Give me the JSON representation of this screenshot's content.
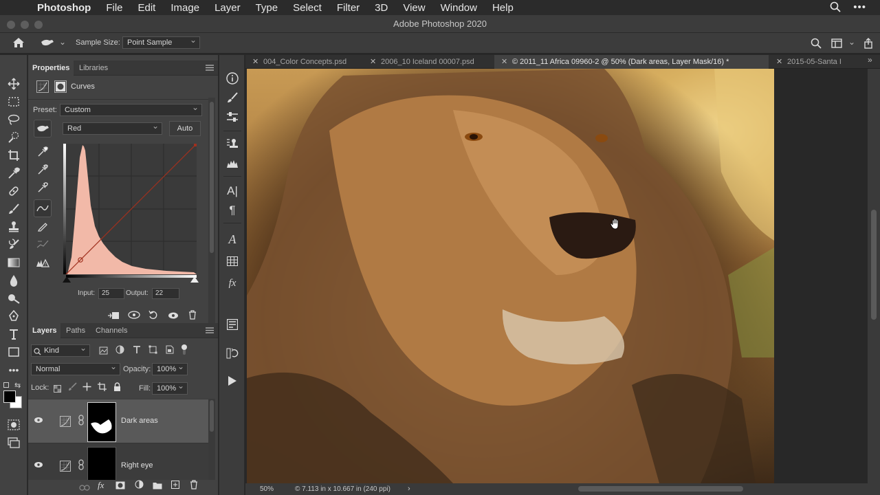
{
  "menubar": {
    "app": "Photoshop",
    "items": [
      "File",
      "Edit",
      "Image",
      "Layer",
      "Type",
      "Select",
      "Filter",
      "3D",
      "View",
      "Window",
      "Help"
    ]
  },
  "window": {
    "title": "Adobe Photoshop 2020"
  },
  "options": {
    "sample_size_label": "Sample Size:",
    "sample_size_value": "Point Sample"
  },
  "tabs": [
    {
      "label": "004_Color Concepts.psd"
    },
    {
      "label": "2006_10 Iceland 00007.psd"
    },
    {
      "label": "© 2011_11 Africa 09960-2 @ 50% (Dark areas, Layer Mask/16) *"
    },
    {
      "label": "2015-05-Santa I"
    }
  ],
  "properties": {
    "tabs": [
      "Properties",
      "Libraries"
    ],
    "title": "Curves",
    "preset_label": "Preset:",
    "preset_value": "Custom",
    "channel_value": "Red",
    "auto_label": "Auto",
    "input_label": "Input:",
    "input_value": "25",
    "output_label": "Output:",
    "output_value": "22"
  },
  "layers": {
    "tabs": [
      "Layers",
      "Paths",
      "Channels"
    ],
    "filter_value": "Kind",
    "blend_mode": "Normal",
    "opacity_label": "Opacity:",
    "opacity_value": "100%",
    "lock_label": "Lock:",
    "fill_label": "Fill:",
    "fill_value": "100%",
    "items": [
      {
        "name": "Dark areas"
      },
      {
        "name": "Right eye"
      }
    ]
  },
  "status": {
    "zoom": "50%",
    "doc_info": "© 7.113 in x 10.667 in (240 ppi)"
  },
  "colors": {
    "accent_curve": "#a0301e",
    "histogram_fill": "#f2b9a8"
  }
}
